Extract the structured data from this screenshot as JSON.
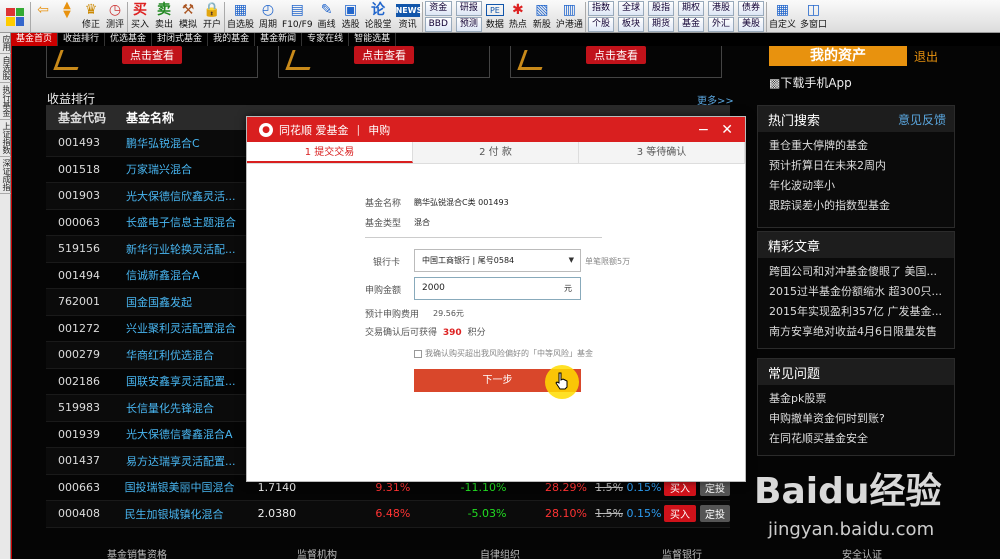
{
  "toolbar": {
    "buttons": [
      {
        "label": "",
        "icon": "back-arrow-icon"
      },
      {
        "label": "",
        "icon": "up-down-icon"
      },
      {
        "label": "修正",
        "icon": "fix-icon"
      },
      {
        "label": "测评",
        "icon": "clock-icon"
      },
      {
        "label": "买入",
        "icon": "buy-icon"
      },
      {
        "label": "卖出",
        "icon": "sell-icon"
      },
      {
        "label": "模拟",
        "icon": "simulate-icon"
      },
      {
        "label": "开户",
        "icon": "open-account-icon"
      },
      {
        "label": "自选股",
        "icon": "watchlist-icon"
      },
      {
        "label": "周期",
        "icon": "period-icon"
      },
      {
        "label": "F10/F9",
        "icon": "f10-icon"
      },
      {
        "label": "画线",
        "icon": "draw-line-icon"
      },
      {
        "label": "选股",
        "icon": "stock-select-icon"
      },
      {
        "label": "论股堂",
        "icon": "forum-icon"
      },
      {
        "label": "资讯",
        "icon": "news-icon"
      }
    ],
    "news_badge": "NEWS",
    "pairs": [
      [
        "资金",
        "BBD"
      ],
      [
        "研报",
        "预测"
      ],
      [
        "PE",
        "数据"
      ],
      [
        "热点",
        ""
      ],
      [
        "新股",
        ""
      ],
      [
        "沪港通",
        ""
      ],
      [
        "指数",
        "个股"
      ],
      [
        "全球",
        "板块"
      ],
      [
        "股指",
        "期货"
      ],
      [
        "期权",
        "基金"
      ],
      [
        "港股",
        "外汇"
      ],
      [
        "债券",
        "美股"
      ]
    ],
    "right_buttons": [
      {
        "label": "自定义"
      },
      {
        "label": "多窗口"
      }
    ]
  },
  "left_strip": [
    "应用",
    "自选股",
    "执行基金",
    "上证指数",
    "深证成指"
  ],
  "tabs": [
    "基金首页",
    "收益排行",
    "优选基金",
    "封闭式基金",
    "我的基金",
    "基金新闻",
    "专家在线",
    "智能选基"
  ],
  "banner_button": "点击查看",
  "section": {
    "title": "收益排行",
    "more": "更多>>"
  },
  "table": {
    "headers": [
      "基金代码",
      "基金名称"
    ],
    "rows": [
      {
        "code": "001493",
        "name": "鹏华弘锐混合C"
      },
      {
        "code": "001518",
        "name": "万家瑞兴混合"
      },
      {
        "code": "001903",
        "name": "光大保德信欣鑫灵活..."
      },
      {
        "code": "000063",
        "name": "长盛电子信息主题混合"
      },
      {
        "code": "519156",
        "name": "新华行业轮换灵活配..."
      },
      {
        "code": "001494",
        "name": "信诚新鑫混合A"
      },
      {
        "code": "762001",
        "name": "国金国鑫发起"
      },
      {
        "code": "001272",
        "name": "兴业聚利灵活配置混合"
      },
      {
        "code": "000279",
        "name": "华商红利优选混合"
      },
      {
        "code": "002186",
        "name": "国联安鑫享灵活配置..."
      },
      {
        "code": "519983",
        "name": "长信量化先锋混合"
      },
      {
        "code": "001939",
        "name": "光大保德信睿鑫混合A"
      },
      {
        "code": "001437",
        "name": "易方达瑞享灵活配置..."
      },
      {
        "code": "000663",
        "name": "国投瑞银美丽中国混合",
        "nav": "1.7140",
        "r1": "9.31%",
        "r2": "-11.10%",
        "r3": "28.29%",
        "fee_old": "1.5%",
        "fee_new": "0.15%"
      },
      {
        "code": "000408",
        "name": "民生加银城镇化混合",
        "nav": "2.0380",
        "r1": "6.48%",
        "r2": "-5.03%",
        "r3": "28.10%",
        "fee_old": "1.5%",
        "fee_new": "0.15%"
      }
    ],
    "buy_label": "买入",
    "fix_label": "定投"
  },
  "right_panel": {
    "asset_button": "我的资产",
    "logout": "退出",
    "download": "下载手机App",
    "hot": {
      "title": "热门搜索",
      "link": "意见反馈",
      "items": [
        "重仓重大停牌的基金",
        "预计折算日在未来2周内",
        "年化波动率小",
        "跟踪误差小的指数型基金"
      ]
    },
    "articles": {
      "title": "精彩文章",
      "items": [
        "跨国公司和对冲基金傻眼了 美国...",
        "2015过半基金份额缩水 超300只...",
        "2015年实现盈利357亿 广发基金...",
        "南方安享绝对收益4月6日限量发售"
      ]
    },
    "faq": {
      "title": "常见问题",
      "items": [
        "基金pk股票",
        "申购撤单资金何时到账?",
        "在同花顺买基金安全"
      ]
    }
  },
  "bottom_links": [
    "基金销售资格",
    "监督机构",
    "自律组织",
    "监督银行",
    "安全认证"
  ],
  "modal": {
    "app_name": "同花顺 爱基金",
    "title": "申购",
    "steps": [
      "1 提交交易",
      "2 付  款",
      "3 等待确认"
    ],
    "fund_name_label": "基金名称",
    "fund_name": "鹏华弘锐混合C类 001493",
    "fund_type_label": "基金类型",
    "fund_type": "混合",
    "bank_label": "银行卡",
    "bank_value": "中国工商银行 | 尾号0584",
    "bank_limit": "单笔限额5万",
    "amount_label": "申购金额",
    "amount_value": "2000",
    "amount_unit": "元",
    "fee_label": "预计申购费用",
    "fee_value": "29.56元",
    "points_prefix": "交易确认后可获得",
    "points_value": "390",
    "points_suffix": "积分",
    "agree_text": "我确认购买超出我风险偏好的「中等风险」基金",
    "next_button": "下一步"
  },
  "watermark": {
    "logo": "Baidu经验",
    "url": "jingyan.baidu.com"
  },
  "colors": {
    "accent": "#d91f1f",
    "orange": "#e8920e",
    "link": "#48b5f0",
    "up": "#ff3333",
    "down": "#22dd22"
  }
}
